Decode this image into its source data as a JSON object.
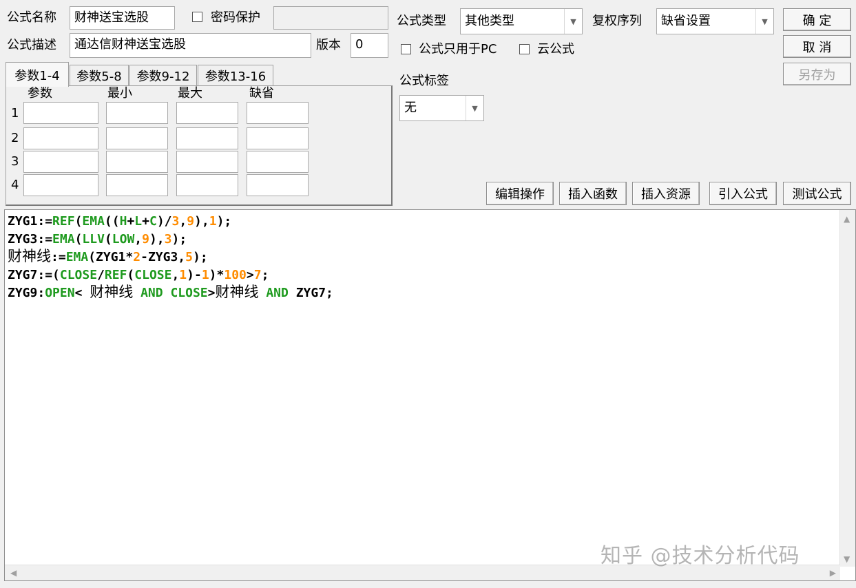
{
  "form": {
    "name_label": "公式名称",
    "name_value": "财神送宝选股",
    "password_label": "密码保护",
    "password_checked": false,
    "password_value": "",
    "desc_label": "公式描述",
    "desc_value": "通达信财神送宝选股",
    "version_label": "版本",
    "version_value": "0",
    "type_label": "公式类型",
    "type_value": "其他类型",
    "rights_label": "复权序列",
    "rights_value": "缺省设置",
    "pc_only_label": "公式只用于PC",
    "pc_only_checked": false,
    "cloud_label": "云公式",
    "cloud_checked": false,
    "tag_label": "公式标签",
    "tag_value": "无"
  },
  "buttons": {
    "ok": "确  定",
    "cancel": "取  消",
    "save_as": "另存为",
    "edit_ops": "编辑操作",
    "insert_func": "插入函数",
    "insert_res": "插入资源",
    "import_formula": "引入公式",
    "test_formula": "测试公式"
  },
  "tabs": [
    "参数1-4",
    "参数5-8",
    "参数9-12",
    "参数13-16"
  ],
  "params": {
    "headers": [
      "参数",
      "最小",
      "最大",
      "缺省"
    ],
    "rows": [
      "1",
      "2",
      "3",
      "4"
    ]
  },
  "code_lines": [
    "ZYG1:=REF(EMA((H+L+C)/3,9),1);",
    "ZYG3:=EMA(LLV(LOW,9),3);",
    "财神线:=EMA(ZYG1*2-ZYG3,5);",
    "ZYG7:=(CLOSE/REF(CLOSE,1)-1)*100>7;",
    "ZYG9:OPEN< 财神线 AND CLOSE>财神线 AND ZYG7;"
  ],
  "colors": {
    "function": "#1e9a1e",
    "number": "#ff8c00",
    "text": "#000000"
  },
  "watermark": "知乎 @技术分析代码"
}
